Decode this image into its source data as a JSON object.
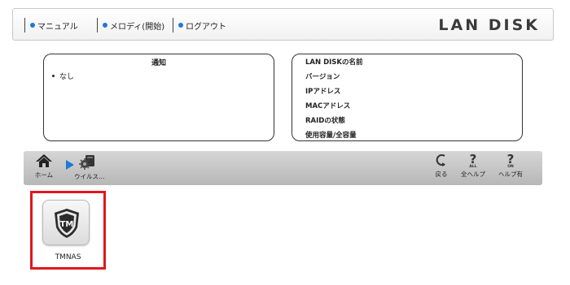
{
  "header": {
    "menu": [
      {
        "label": "マニュアル"
      },
      {
        "label": "メロディ(開始)"
      },
      {
        "label": "ログアウト"
      }
    ],
    "logo": "LAN DISK"
  },
  "notice_panel": {
    "title": "通知",
    "items": [
      "なし"
    ]
  },
  "info_panel": {
    "rows": [
      "LAN DISKの名前",
      "バージョン",
      "IPアドレス",
      "MACアドレス",
      "RAIDの状態",
      "使用容量/全容量"
    ]
  },
  "toolbar": {
    "home_label": "ホーム",
    "virus_label": "ウイルス…",
    "back_label": "戻る",
    "all_help_label": "全ヘルプ",
    "all_help_sub": "ALL",
    "help_on_label": "ヘルプ有",
    "help_on_sub": "ON"
  },
  "app": {
    "label": "TMNAS",
    "icon_text": "TM"
  },
  "colors": {
    "accent": "#1e7ad6",
    "selection": "#e0171e"
  }
}
